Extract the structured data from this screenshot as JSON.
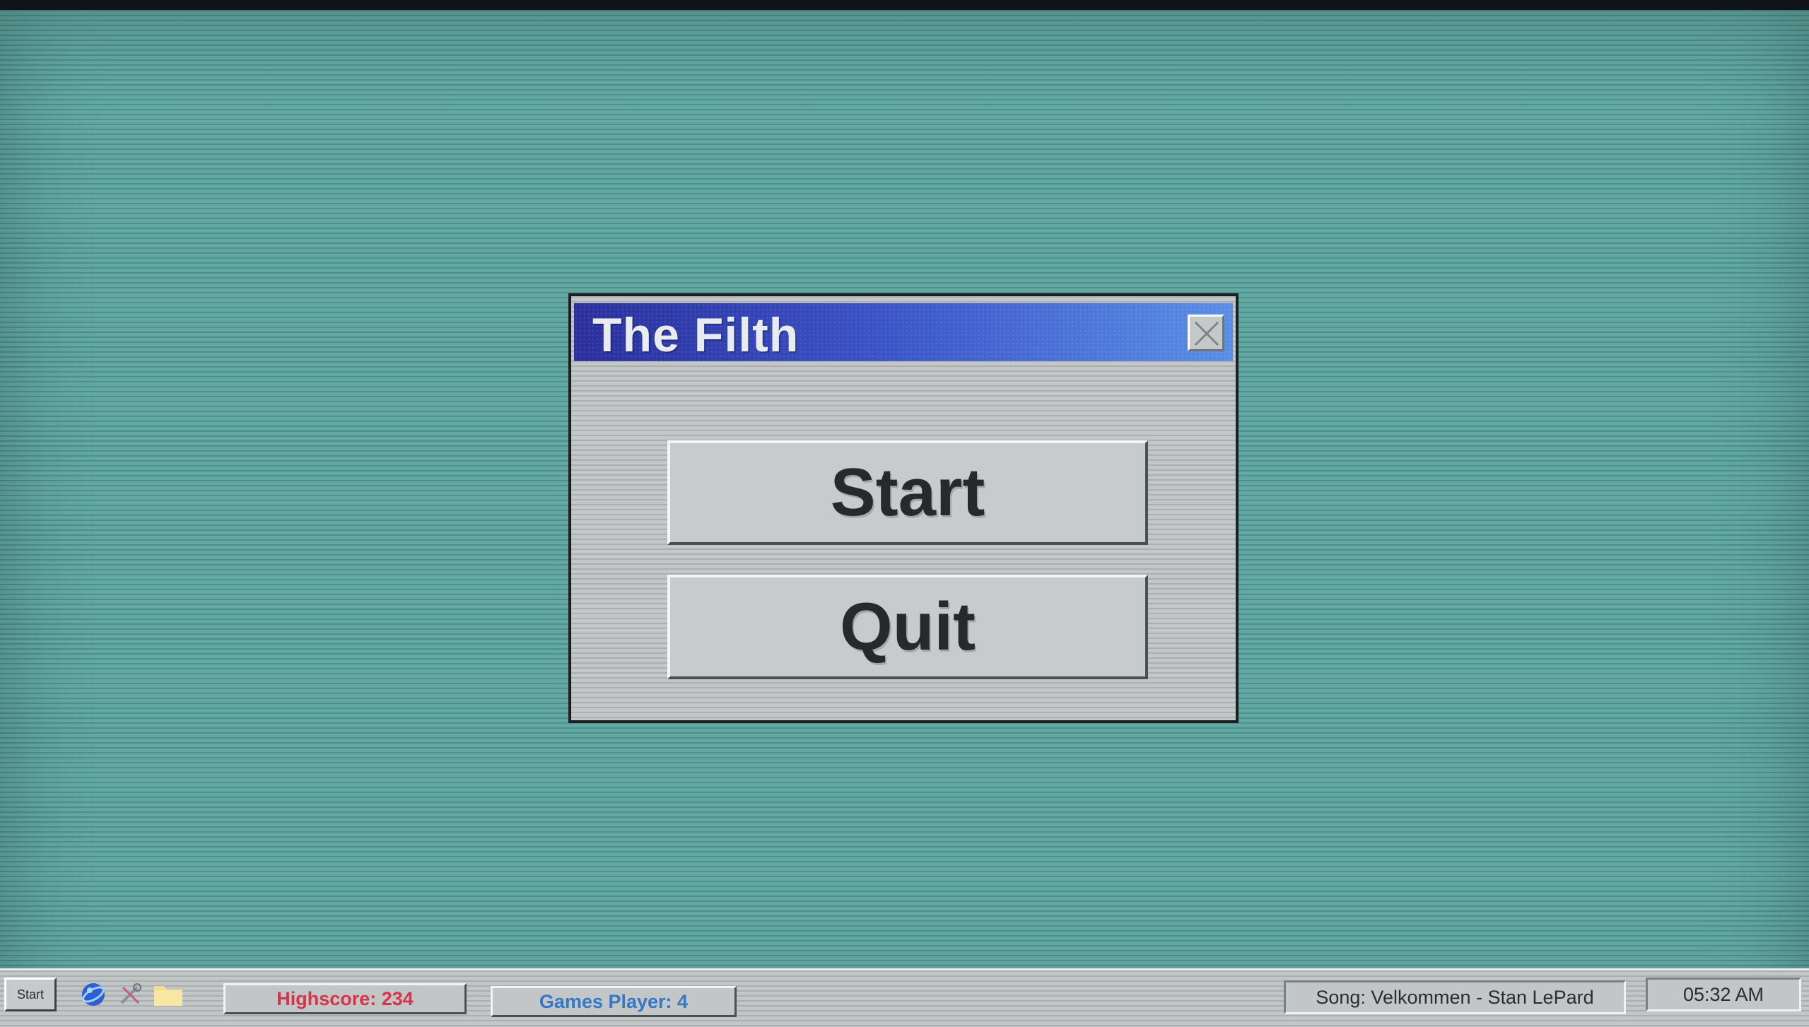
{
  "window": {
    "title": "The Filth",
    "buttons": {
      "start_label": "Start",
      "quit_label": "Quit"
    }
  },
  "taskbar": {
    "start_label": "Start",
    "icons": [
      "globe-icon",
      "tools-icon",
      "folder-icon"
    ],
    "highscore": "Highscore: 234",
    "games_played": "Games Player: 4",
    "song": "Song: Velkommen - Stan LePard",
    "clock": "05:32 AM"
  },
  "colors": {
    "desktop": "#5fa7a1",
    "titlebar_start": "#2a2f9c",
    "titlebar_end": "#5a8ee6",
    "window_face": "#c3c7c7",
    "highscore": "#d8334a",
    "games": "#3578c8"
  }
}
